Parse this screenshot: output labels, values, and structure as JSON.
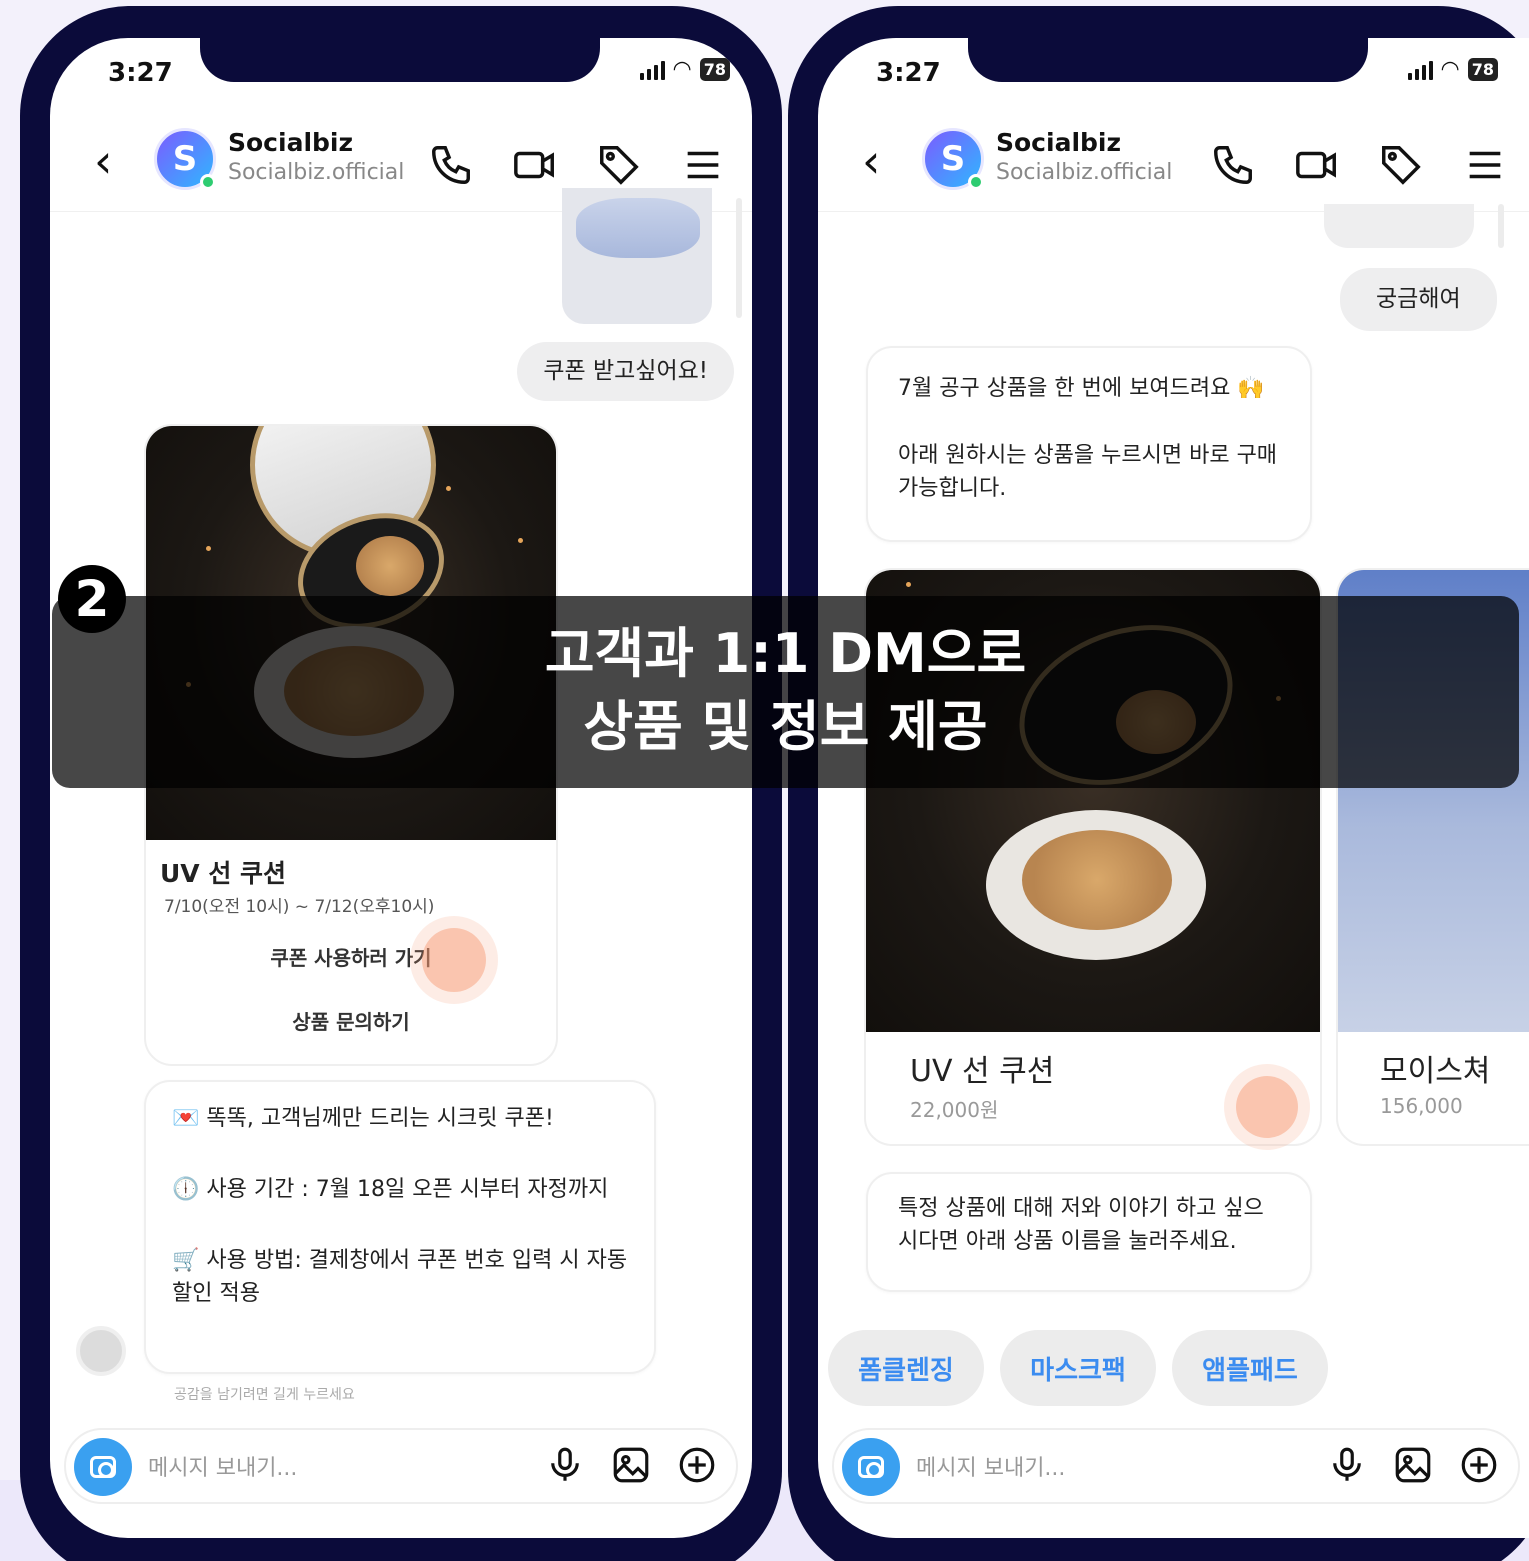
{
  "status": {
    "time": "3:27",
    "battery": "78"
  },
  "profile": {
    "name": "Socialbiz",
    "handle": "Socialbiz.official",
    "avatar_letter": "S"
  },
  "left": {
    "user_message": "쿠폰 받고싶어요!",
    "product": {
      "title": "UV 선 쿠션",
      "period": "7/10(오전 10시) ~ 7/12(오후10시)",
      "button_coupon": "쿠폰 사용하러 가기",
      "button_inquiry": "상품 문의하기"
    },
    "coupon_message": {
      "line1": "💌 똑똑, 고객님께만 드리는 시크릿 쿠폰!",
      "line2": "🕕 사용 기간 : 7월 18일 오픈 시부터 자정까지",
      "line3": "🛒 사용 방법: 결제창에서 쿠폰 번호 입력 시 자동 할인 적용"
    },
    "hint": "공감을 남기려면 길게 누르세요"
  },
  "right": {
    "user_message": "궁금해여",
    "bot_message": {
      "line1": "7월 공구 상품을 한 번에 보여드려요 🙌",
      "line2": "아래 원하시는 상품을 누르시면 바로 구매 가능합니다."
    },
    "products": [
      {
        "title": "UV 선 쿠션",
        "price": "22,000원"
      },
      {
        "title": "모이스쳐",
        "price": "156,000"
      }
    ],
    "bot_message2": "특정 상품에 대해 저와 이야기 하고 싶으시다면 아래 상품 이름을 눌러주세요.",
    "chips": [
      "폼클렌징",
      "마스크팩",
      "앰플패드"
    ]
  },
  "input": {
    "placeholder": "메시지 보내기..."
  },
  "overlay": {
    "step": "2",
    "line1": "고객과 1:1 DM으로",
    "line2": "상품 및 정보 제공"
  },
  "colors": {
    "frame": "#0b0b3a",
    "accent": "#3b8cf0",
    "touch": "#f6966e"
  },
  "icons": [
    "back-icon",
    "phone-icon",
    "video-icon",
    "tag-icon",
    "menu-icon",
    "camera-icon",
    "mic-icon",
    "gallery-icon",
    "plus-icon"
  ]
}
